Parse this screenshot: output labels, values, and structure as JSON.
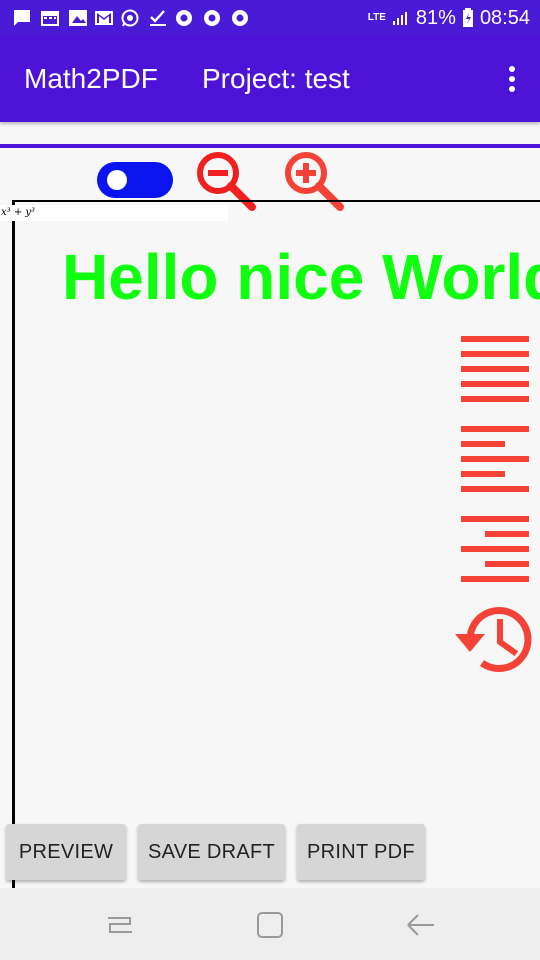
{
  "status_bar": {
    "battery_percent": "81%",
    "time": "08:54",
    "network_label": "LTE",
    "notification_icons": [
      "message-icon",
      "calendar-icon",
      "gallery-icon",
      "gmail-icon",
      "whatsapp-icon",
      "check-icon",
      "chrome-icon",
      "chrome-icon",
      "chrome-icon"
    ]
  },
  "app_bar": {
    "app_title": "Math2PDF",
    "project_title": "Project: test"
  },
  "canvas": {
    "formula_text": "x³ + y³",
    "headline_text": "Hello nice World",
    "headline_color": "#10ff10"
  },
  "toolbar": {
    "toggle_on": true,
    "toggle_color": "#0a14ef",
    "zoom_out_icon": "zoom-out-icon",
    "zoom_in_icon": "zoom-in-icon",
    "align_icons": [
      "align-justify-icon",
      "align-left-icon",
      "align-right-icon"
    ],
    "history_icon": "history-icon",
    "accent_color": "#f44336"
  },
  "buttons": {
    "preview": "PREVIEW",
    "save_draft": "SAVE DRAFT",
    "print_pdf": "PRINT PDF"
  },
  "colors": {
    "app_bar": "#4d13d6",
    "status_bar": "#4a1bd6"
  }
}
